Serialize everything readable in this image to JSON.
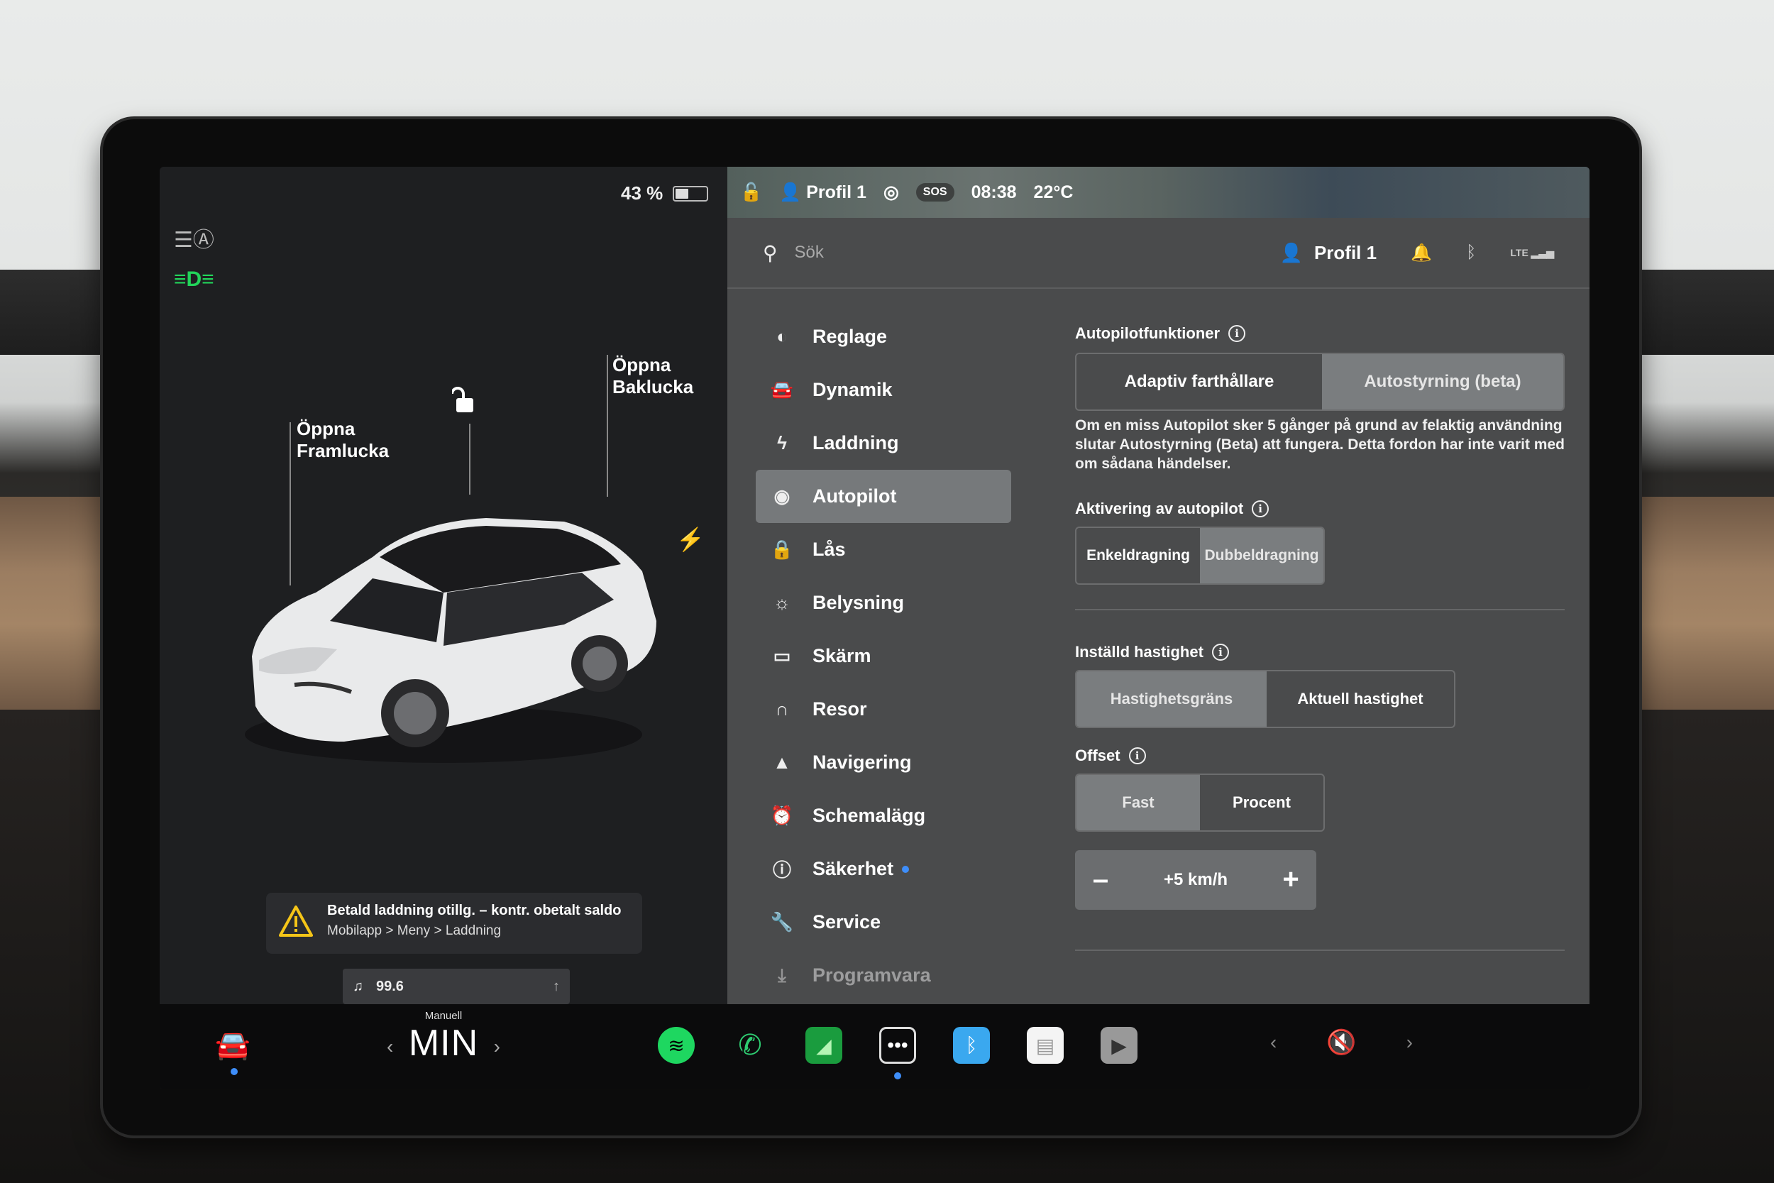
{
  "car": {
    "battery_percent": "43 %",
    "frunk_label_line1": "Öppna",
    "frunk_label_line2": "Framlucka",
    "trunk_label_line1": "Öppna",
    "trunk_label_line2": "Baklucka",
    "notice_line1": "Betald laddning otillg. – kontr. obetalt saldo",
    "notice_line2": "Mobilapp > Meny > Laddning",
    "media_station": "99.6"
  },
  "statusbar": {
    "profile": "Profil 1",
    "sos": "SOS",
    "time": "08:38",
    "temperature": "22°C"
  },
  "searchbar": {
    "placeholder": "Sök",
    "profile": "Profil 1",
    "network": "LTE"
  },
  "menu": {
    "items": [
      {
        "label": "Reglage",
        "icon": "toggle-icon"
      },
      {
        "label": "Dynamik",
        "icon": "car-icon"
      },
      {
        "label": "Laddning",
        "icon": "bolt-icon"
      },
      {
        "label": "Autopilot",
        "icon": "steering-wheel-icon",
        "active": true
      },
      {
        "label": "Lås",
        "icon": "lock-icon"
      },
      {
        "label": "Belysning",
        "icon": "sun-icon"
      },
      {
        "label": "Skärm",
        "icon": "display-icon"
      },
      {
        "label": "Resor",
        "icon": "trips-icon"
      },
      {
        "label": "Navigering",
        "icon": "navigation-arrow-icon"
      },
      {
        "label": "Schemalägg",
        "icon": "alarm-clock-icon"
      },
      {
        "label": "Säkerhet",
        "icon": "info-circle-icon",
        "badge": true
      },
      {
        "label": "Service",
        "icon": "wrench-icon"
      },
      {
        "label": "Programvara",
        "icon": "download-icon"
      }
    ]
  },
  "autopilot": {
    "features_title": "Autopilotfunktioner",
    "option_adaptive": "Adaptiv farthållare",
    "option_autosteer": "Autostyrning (beta)",
    "selected_feature": "Autostyrning (beta)",
    "description": "Om en miss Autopilot sker 5 gånger på grund av felaktig användning slutar Autostyrning (Beta) att fungera. Detta fordon har inte varit med om sådana händelser.",
    "activation_title": "Aktivering av autopilot",
    "activation_single": "Enkeldragning",
    "activation_double": "Dubbeldragning",
    "selected_activation": "Dubbeldragning",
    "speed_title": "Inställd hastighet",
    "speed_limit": "Hastighetsgräns",
    "speed_current": "Aktuell hastighet",
    "selected_speed": "Hastighetsgräns",
    "offset_title": "Offset",
    "offset_fixed": "Fast",
    "offset_percent": "Procent",
    "selected_offset": "Fast",
    "offset_value": "+5 km/h"
  },
  "dock": {
    "gear_mode": "Manuell",
    "gear_value": "MIN"
  },
  "colors": {
    "accent_blue": "#3e8efa",
    "headlight_green": "#22d45a",
    "spotify_green": "#1ed760",
    "phone_green": "#2ecc71"
  }
}
